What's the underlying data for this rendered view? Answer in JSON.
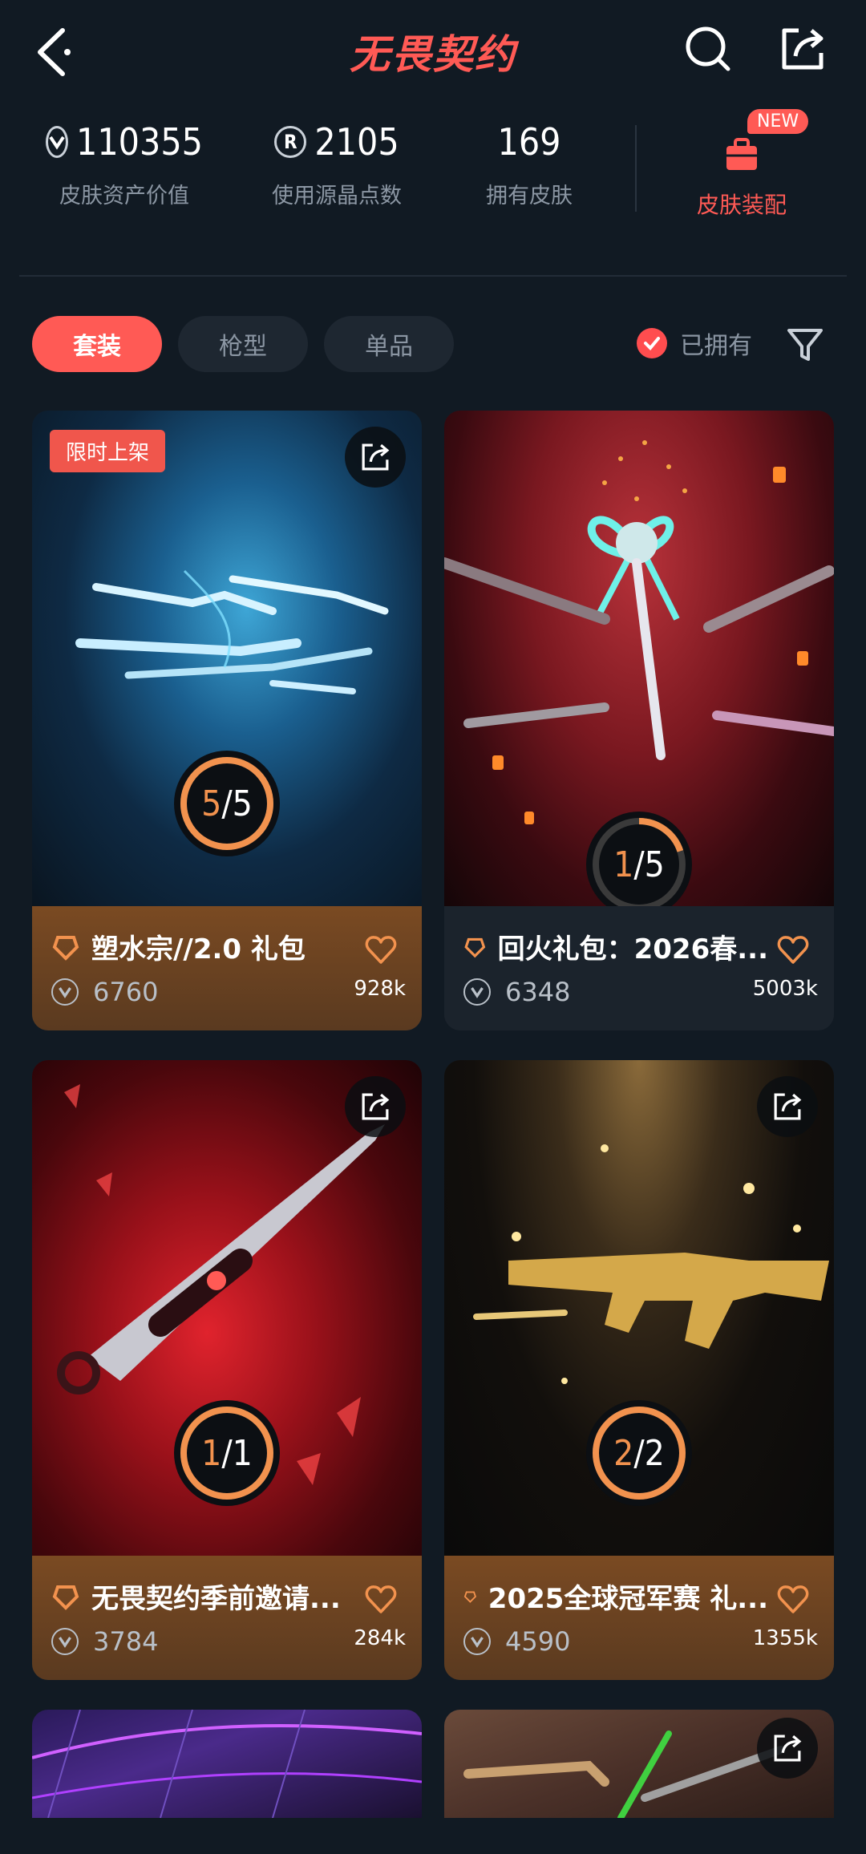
{
  "header": {
    "title": "无畏契约"
  },
  "stats": [
    {
      "value": "110355",
      "label": "皮肤资产价值",
      "icon": "vp-coin-icon"
    },
    {
      "value": "2105",
      "label": "使用源晶点数",
      "icon": "radianite-icon"
    },
    {
      "value": "169",
      "label": "拥有皮肤"
    }
  ],
  "equip": {
    "label": "皮肤装配",
    "badge": "NEW"
  },
  "tabs": [
    {
      "label": "套装",
      "active": true
    },
    {
      "label": "枪型",
      "active": false
    },
    {
      "label": "单品",
      "active": false
    }
  ],
  "owned_filter": {
    "label": "已拥有",
    "checked": true
  },
  "cards": [
    {
      "name": "塑水宗//2.0 礼包",
      "price": "6760",
      "views": "928k",
      "owned": 5,
      "total": 5,
      "progress_text_a": "5",
      "progress_text_b": "/5",
      "limited": "限时上架",
      "footer_color": "brown"
    },
    {
      "name": "回火礼包：2026春...",
      "price": "6348",
      "views": "5003k",
      "owned": 1,
      "total": 5,
      "progress_text_a": "1",
      "progress_text_b": "/5",
      "footer_color": "dark"
    },
    {
      "name": "无畏契约季前邀请...",
      "price": "3784",
      "views": "284k",
      "owned": 1,
      "total": 1,
      "progress_text_a": "1",
      "progress_text_b": "/1",
      "footer_color": "brown"
    },
    {
      "name": "2025全球冠军赛 礼...",
      "price": "4590",
      "views": "1355k",
      "owned": 2,
      "total": 2,
      "progress_text_a": "2",
      "progress_text_b": "/2",
      "footer_color": "brown"
    }
  ],
  "colors": {
    "accent": "#ff5a55",
    "progress": "#f2924e",
    "background": "#111a23"
  }
}
